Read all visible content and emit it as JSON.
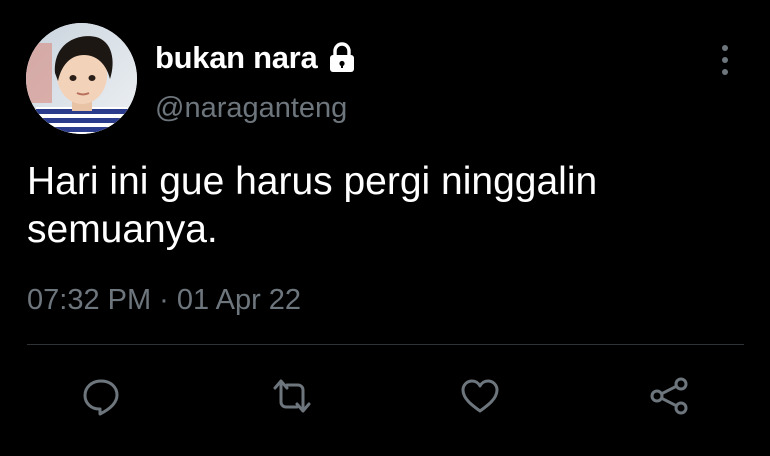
{
  "tweet": {
    "author": {
      "display_name": "bukan nara",
      "handle": "@naraganteng",
      "protected_icon": "lock-icon"
    },
    "text": "Hari ini gue harus pergi ninggalin semuanya.",
    "timestamp": "07:32 PM · 01 Apr 22"
  },
  "actions": [
    {
      "name": "reply",
      "icon": "reply-icon"
    },
    {
      "name": "retweet",
      "icon": "retweet-icon"
    },
    {
      "name": "like",
      "icon": "heart-icon"
    },
    {
      "name": "share",
      "icon": "share-icon"
    }
  ],
  "colors": {
    "background": "#000000",
    "primary_text": "#ffffff",
    "secondary_text": "#6e767d",
    "icon": "#6e767d",
    "divider": "#2f3336"
  }
}
